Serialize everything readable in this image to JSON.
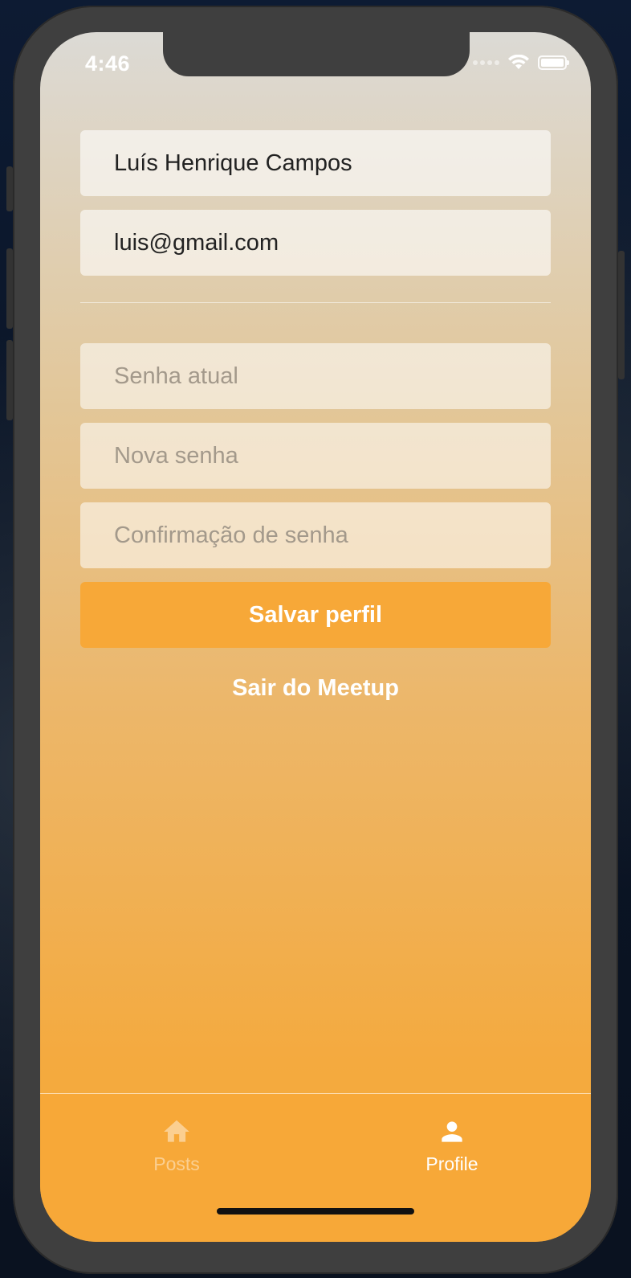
{
  "status_bar": {
    "time": "4:46"
  },
  "profile_form": {
    "name_value": "Luís Henrique Campos",
    "email_value": "luis@gmail.com",
    "current_password_placeholder": "Senha atual",
    "new_password_placeholder": "Nova senha",
    "confirm_password_placeholder": "Confirmação de senha",
    "save_label": "Salvar perfil",
    "logout_label": "Sair do Meetup"
  },
  "tab_bar": {
    "tabs": [
      {
        "label": "Posts",
        "icon": "home-icon",
        "active": false
      },
      {
        "label": "Profile",
        "icon": "person-icon",
        "active": true
      }
    ]
  },
  "colors": {
    "accent": "#f7a838",
    "gradient_top": "#dcdad5",
    "inactive_tab": "rgba(255,255,255,0.45)"
  }
}
